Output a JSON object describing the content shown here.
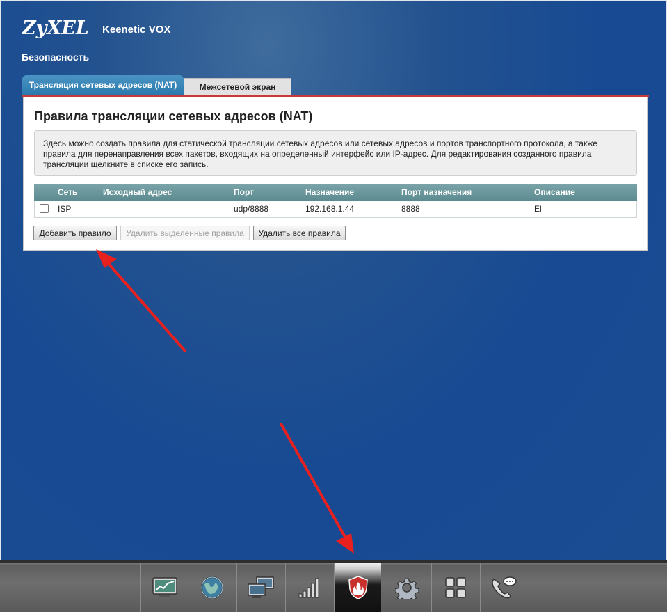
{
  "header": {
    "logo": "ZyXEL",
    "model": "Keenetic VOX",
    "section_title": "Безопасность"
  },
  "tabs": [
    {
      "label": "Трансляция сетевых адресов (NAT)",
      "active": true
    },
    {
      "label": "Межсетевой экран",
      "active": false
    }
  ],
  "panel": {
    "title": "Правила трансляции сетевых адресов (NAT)",
    "info_lines": [
      "Здесь можно создать правила для статической трансляции сетевых адресов или сетевых адресов и портов транспортного протокола, а также",
      "правила для перенаправления всех пакетов, входящих на определенный интерфейс или IP-адрес. Для редактирования созданного правила",
      "трансляции щелкните в списке его запись."
    ]
  },
  "table": {
    "columns": [
      "Сеть",
      "Исходный адрес",
      "Порт",
      "Назначение",
      "Порт назначения",
      "Описание"
    ],
    "rows": [
      {
        "network": "ISP",
        "source": "",
        "port": "udp/8888",
        "destination": "192.168.1.44",
        "dest_port": "8888",
        "description": "El"
      }
    ]
  },
  "buttons": {
    "add": "Добавить правило",
    "delete_selected": "Удалить выделенные правила",
    "delete_all": "Удалить все правила"
  },
  "taskbar": {
    "items": [
      {
        "icon": "monitor-chart-icon"
      },
      {
        "icon": "globe-icon"
      },
      {
        "icon": "network-computers-icon"
      },
      {
        "icon": "signal-bars-icon"
      },
      {
        "icon": "shield-flame-icon",
        "active": true
      },
      {
        "icon": "gear-icon"
      },
      {
        "icon": "apps-grid-icon"
      },
      {
        "icon": "phone-chat-icon"
      }
    ]
  },
  "colors": {
    "accent_tab": "#2b79ad",
    "red_line": "#c83a3a",
    "annotation_arrow": "#e8201e"
  }
}
